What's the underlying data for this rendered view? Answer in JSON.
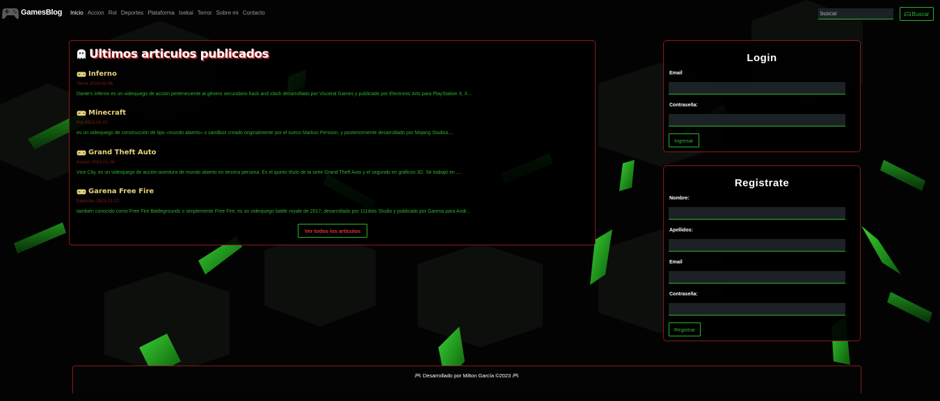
{
  "navbar": {
    "brand": "GamesBlog",
    "links": [
      {
        "label": "Inicio",
        "active": true
      },
      {
        "label": "Accion"
      },
      {
        "label": "Rol"
      },
      {
        "label": "Deportes"
      },
      {
        "label": "Plataforma"
      },
      {
        "label": "Isekai"
      },
      {
        "label": "Terror"
      },
      {
        "label": "Sobre mi"
      },
      {
        "label": "Contacto"
      }
    ],
    "search_placeholder": "buscar",
    "search_button": "Buscar"
  },
  "articles": {
    "title": "Ultimos articulos publicados",
    "items": [
      {
        "title": "Inferno",
        "category": "Terror",
        "date": "2023-02-06",
        "excerpt": "Dante's Inferno es un videojuego de acción perteneciente al género secundario hack and slash desarrollado por Visceral Games y publicado por Electronic Arts para PlayStation 3, X..."
      },
      {
        "title": "Minecraft",
        "category": "Rol",
        "date": "2023-02-02",
        "excerpt": "es un videojuego de construcción de tipo «mundo abierto» o sandbox creado originalmente por el sueco Markus Persson,  y posteriormente desarrollado por Mojang Studios...."
      },
      {
        "title": "Grand Theft Auto",
        "category": "Accion",
        "date": "2023-01-28",
        "excerpt": "Vice City, es un videojuego de acción-aventura de mundo abierto en tercera persona. Es el quinto título de la serie Grand Theft Auto y el segundo en gráficos 3D. Se trabajó en ...."
      },
      {
        "title": "Garena Free Fire",
        "category": "Deportes",
        "date": "2023-01-27",
        "excerpt": "también conocido como Free Fire Battlegrounds o simplemente Free Fire, es un videojuego battle royale de 2017, desarrollado por 111dots Studio y publicado por Garena para Andr..."
      }
    ],
    "view_all": "Ver todos los articulos"
  },
  "login": {
    "title": "Login",
    "email_label": "Email",
    "password_label": "Contraseña:",
    "submit": "Ingresar"
  },
  "register": {
    "title": "Registrate",
    "name_label": "Nombre:",
    "lastname_label": "Apellidos:",
    "email_label": "Email",
    "password_label": "Contraseña:",
    "submit": "Registrar"
  },
  "footer": {
    "text": "Desarrollado por Milton García ©2023"
  },
  "colors": {
    "accent_green": "#2db82d",
    "border_red": "#8b1a1a",
    "link_red": "#e0313a",
    "title_gold": "#e8d37a",
    "input_bg": "#1c2126"
  }
}
